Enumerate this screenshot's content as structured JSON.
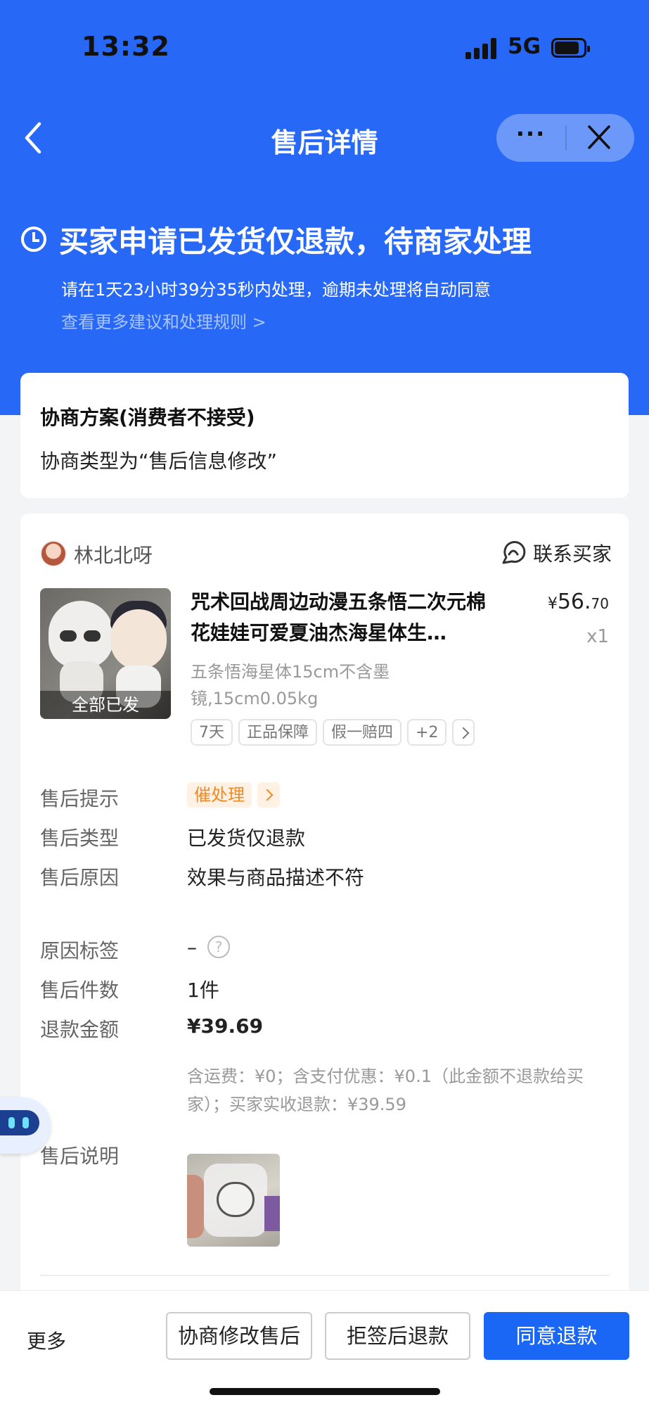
{
  "status_bar": {
    "time": "13:32",
    "network": "5G"
  },
  "nav": {
    "title": "售后详情",
    "more_label": "···"
  },
  "status": {
    "title": "买家申请已发货仅退款，待商家处理",
    "countdown": "请在1天23小时39分35秒内处理，逾期未处理将自动同意",
    "rules_link": "查看更多建议和处理规则 >"
  },
  "negotiation": {
    "title": "协商方案(消费者不接受)",
    "text": "协商类型为“售后信息修改”"
  },
  "buyer": {
    "name": "林北北呀",
    "contact_label": "联系买家"
  },
  "product": {
    "thumb_label": "全部已发",
    "title": "咒术回战周边动漫五条悟二次元棉花娃娃可爱夏油杰海星体生…",
    "price_currency": "¥",
    "price_integer": "56.",
    "price_decimal": "70",
    "quantity": "x1",
    "spec": "五条悟海星体15cm不含墨镜,15cm0.05kg",
    "tags": [
      "7天",
      "正品保障",
      "假一赔四",
      "+2"
    ]
  },
  "details": {
    "hint_label": "售后提示",
    "urge_label": "催处理",
    "type_label": "售后类型",
    "type_value": "已发货仅退款",
    "reason_label": "售后原因",
    "reason_value": "效果与商品描述不符",
    "reason_tag_label": "原因标签",
    "reason_tag_value": "–",
    "count_label": "售后件数",
    "count_value": "1件",
    "refund_label": "退款金额",
    "refund_value": "¥39.69",
    "refund_note": "含运费：¥0；含支付优惠：¥0.1（此金额不退款给买家）；买家实收退款：¥39.59",
    "desc_label": "售后说明"
  },
  "actions": {
    "more": "更多",
    "negotiate": "协商修改售后",
    "reject": "拒签后退款",
    "agree": "同意退款"
  },
  "colors": {
    "brand": "#2769f6",
    "primary_button": "#1a66f5",
    "urge": "#f08a24"
  }
}
